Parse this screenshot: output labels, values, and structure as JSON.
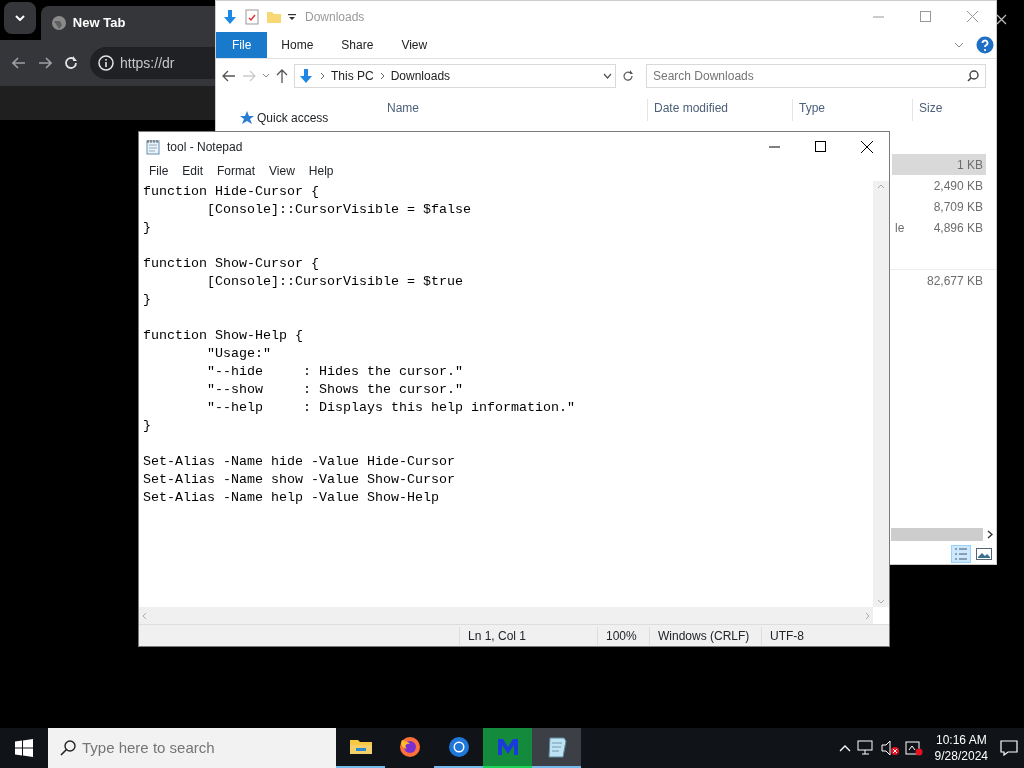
{
  "browser": {
    "tab_title": "New Tab",
    "address": "https://dr"
  },
  "explorer": {
    "title": "Downloads",
    "ribbon_tabs": [
      {
        "label": "File",
        "selected": true
      },
      {
        "label": "Home",
        "selected": false
      },
      {
        "label": "Share",
        "selected": false
      },
      {
        "label": "View",
        "selected": false
      }
    ],
    "breadcrumb": [
      "This PC",
      "Downloads"
    ],
    "search": {
      "placeholder": "Search Downloads"
    },
    "columns": [
      "Name",
      "Date modified",
      "Type",
      "Size"
    ],
    "sidebar": {
      "items": [
        {
          "label": "Quick access"
        }
      ]
    },
    "rows": [
      {
        "size": "1 KB",
        "selected": true,
        "group_start": false
      },
      {
        "size": "2,490 KB",
        "selected": false,
        "group_start": false
      },
      {
        "size": "8,709 KB",
        "selected": false,
        "group_start": false
      },
      {
        "type": "le",
        "size": "4,896 KB",
        "selected": false,
        "group_start": false
      },
      {
        "size": "82,677 KB",
        "selected": false,
        "group_start": true
      }
    ]
  },
  "notepad": {
    "title": "tool - Notepad",
    "menu": [
      "File",
      "Edit",
      "Format",
      "View",
      "Help"
    ],
    "text": "function Hide-Cursor {\n\t[Console]::CursorVisible = $false\n}\n\nfunction Show-Cursor {\n\t[Console]::CursorVisible = $true\n}\n\nfunction Show-Help {\n\t\"Usage:\"\n\t\"--hide     : Hides the cursor.\"\n\t\"--show     : Shows the cursor.\"\n\t\"--help     : Displays this help information.\"\n}\n\nSet-Alias -Name hide -Value Hide-Cursor\nSet-Alias -Name show -Value Show-Cursor\nSet-Alias -Name help -Value Show-Help",
    "status": {
      "position": "Ln 1, Col 1",
      "zoom": "100%",
      "line_ending": "Windows (CRLF)",
      "encoding": "UTF-8"
    }
  },
  "taskbar": {
    "search_placeholder": "Type here to search",
    "apps": [
      {
        "kind": "explorer",
        "running": true,
        "focused": false,
        "attention": false
      },
      {
        "kind": "firefox",
        "running": false,
        "focused": false,
        "attention": false
      },
      {
        "kind": "chrome",
        "running": true,
        "focused": false,
        "attention": false
      },
      {
        "kind": "remote",
        "running": true,
        "focused": false,
        "attention": true
      },
      {
        "kind": "notepad",
        "running": true,
        "focused": true,
        "attention": false
      }
    ],
    "volume_muted": true,
    "clock": {
      "time": "10:16 AM",
      "date": "9/28/2024"
    }
  }
}
